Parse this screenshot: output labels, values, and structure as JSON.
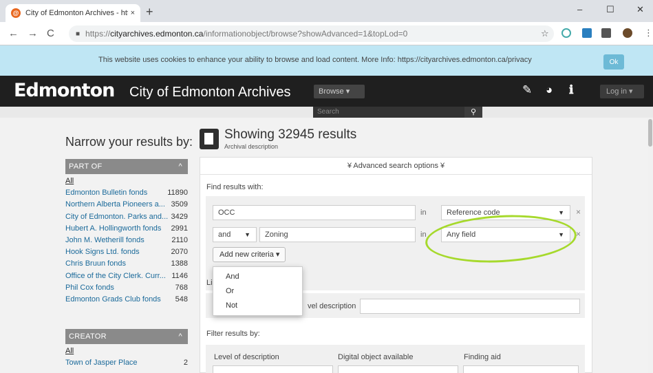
{
  "browser": {
    "tab_title": "City of Edmonton Archives - http",
    "tab_favicon": "@",
    "tab_close": "×",
    "new_tab": "+",
    "url_scheme": "https://",
    "url_host": "cityarchives.edmonton.ca",
    "url_path": "/informationobject/browse?showAdvanced=1&topLod=0",
    "window_controls": [
      "–",
      "☐",
      "✕"
    ],
    "nav": {
      "back": "←",
      "forward": "→",
      "reload": "C"
    }
  },
  "cookie_banner": {
    "text": "This website uses cookies to enhance your ability to browse and load content. More Info: https://cityarchives.edmonton.ca/privacy",
    "ok_label": "Ok",
    "bg_color": "#bfe6f4"
  },
  "site_header": {
    "logo": "Edmonton",
    "title": "City of Edmonton Archives",
    "browse_label": "Browse ▾",
    "login_label": "Log in ▾",
    "search_placeholder": "Search",
    "icons": [
      "clipboard-icon",
      "globe-icon",
      "info-icon"
    ]
  },
  "sidebar": {
    "title": "Narrow your results by:",
    "part_of": {
      "header": "PART OF",
      "all_label": "All",
      "items": [
        {
          "label": "Edmonton Bulletin fonds",
          "count": "11890"
        },
        {
          "label": "Northern Alberta Pioneers a...",
          "count": "3509"
        },
        {
          "label": "City of Edmonton. Parks and...",
          "count": "3429"
        },
        {
          "label": "Hubert A. Hollingworth fonds",
          "count": "2991"
        },
        {
          "label": "John M. Wetherill fonds",
          "count": "2110"
        },
        {
          "label": "Hook Signs Ltd. fonds",
          "count": "2070"
        },
        {
          "label": "Chris Bruun fonds",
          "count": "1388"
        },
        {
          "label": "Office of the City Clerk. Curr...",
          "count": "1146"
        },
        {
          "label": "Phil Cox fonds",
          "count": "768"
        },
        {
          "label": "Edmonton Grads Club fonds",
          "count": "548"
        }
      ]
    },
    "creator": {
      "header": "CREATOR",
      "all_label": "All",
      "items": [
        {
          "label": "Town of Jasper Place",
          "count": "2"
        }
      ]
    },
    "collapse_caret": "^"
  },
  "results": {
    "title": "Showing 32945 results",
    "subtitle": "Archival description"
  },
  "advanced": {
    "toggle_label": "¥  Advanced search options  ¥",
    "find_label": "Find results with:",
    "row1": {
      "query": "OCC",
      "in_label": "in",
      "field": "Reference code",
      "remove": "×"
    },
    "row2": {
      "operator": "and",
      "query": "Zoning",
      "in_label": "in",
      "field": "Any field",
      "remove": "×"
    },
    "add_criteria_label": "Add new criteria ▾",
    "dropdown_options": [
      "And",
      "Or",
      "Not"
    ],
    "limit_label_prefix": "Li",
    "level_description_label": "vel description",
    "filter_label": "Filter results by:",
    "filter_columns": [
      "Level of description",
      "Digital object available",
      "Finding aid"
    ],
    "highlight_color": "#a6d92c"
  }
}
